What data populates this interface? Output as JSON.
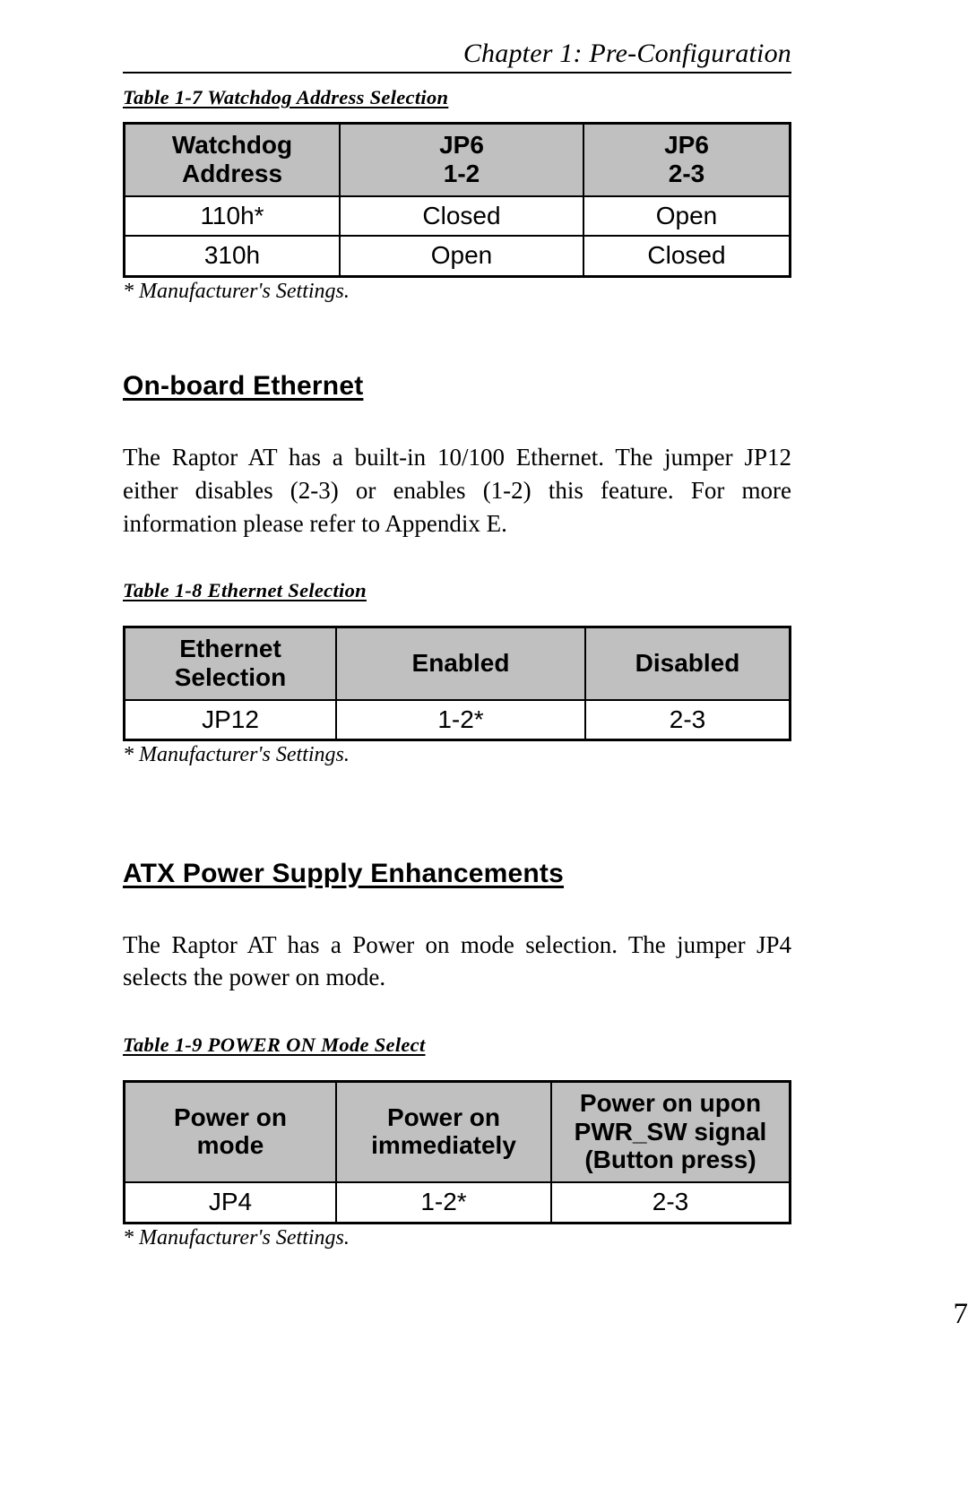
{
  "header": {
    "running_title": "Chapter 1: Pre-Configuration"
  },
  "footer": {
    "page_number": "7"
  },
  "tables": {
    "t17": {
      "caption": "Table 1-7 Watchdog Address Selection",
      "headers": [
        {
          "line1": "Watchdog",
          "line2": "Address"
        },
        {
          "line1": "JP6",
          "line2": "1-2"
        },
        {
          "line1": "JP6",
          "line2": "2-3"
        }
      ],
      "rows": [
        [
          "110h*",
          "Closed",
          "Open"
        ],
        [
          "310h",
          "Open",
          "Closed"
        ]
      ],
      "footnote": "* Manufacturer's Settings."
    },
    "t18": {
      "caption": "Table 1-8 Ethernet Selection",
      "headers": [
        {
          "line1": "Ethernet",
          "line2": "Selection"
        },
        {
          "line1": "Enabled",
          "line2": ""
        },
        {
          "line1": "Disabled",
          "line2": ""
        }
      ],
      "rows": [
        [
          "JP12",
          "1-2*",
          "2-3"
        ]
      ],
      "footnote": "* Manufacturer's Settings."
    },
    "t19": {
      "caption": "Table 1-9 POWER ON Mode Select",
      "headers": [
        {
          "line1": "Power on",
          "line2": "mode",
          "line3": ""
        },
        {
          "line1": "Power on",
          "line2": "immediately",
          "line3": ""
        },
        {
          "line1": "Power on upon",
          "line2": "PWR_SW signal",
          "line3": "(Button press)"
        }
      ],
      "rows": [
        [
          "JP4",
          "1-2*",
          "2-3"
        ]
      ],
      "footnote": "* Manufacturer's Settings."
    }
  },
  "sections": {
    "ethernet": {
      "heading": "On-board Ethernet",
      "paragraph": "The Raptor AT has a built-in 10/100 Ethernet. The jumper JP12 either disables (2-3) or enables (1-2) this feature. For more information please refer to Appendix E."
    },
    "atx": {
      "heading": "ATX Power Supply Enhancements",
      "paragraph": "The Raptor AT has a Power on mode selection. The jumper JP4 selects the power on mode."
    }
  },
  "colors": {
    "header_fill": "#c0c0c0",
    "rule": "#000000",
    "text": "#000000"
  }
}
